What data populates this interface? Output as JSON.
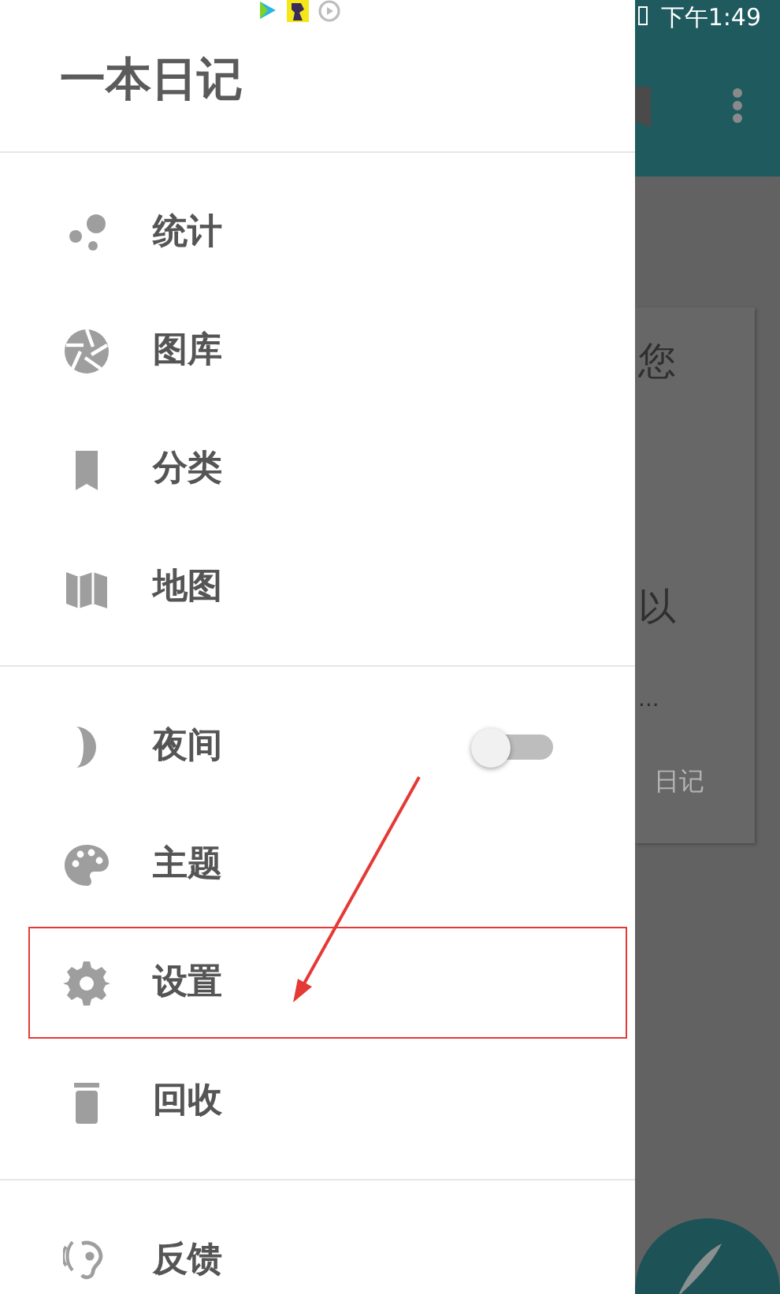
{
  "status_bar": {
    "time": "下午1:49"
  },
  "drawer": {
    "title": "一本日记",
    "groups": [
      {
        "items": [
          {
            "kind": "link",
            "label": "统计",
            "annotated": false
          },
          {
            "kind": "link",
            "label": "图库",
            "annotated": false
          },
          {
            "kind": "link",
            "label": "分类",
            "annotated": false
          },
          {
            "kind": "link",
            "label": "地图",
            "annotated": false
          }
        ]
      },
      {
        "items": [
          {
            "kind": "toggle",
            "label": "夜间",
            "on": false,
            "annotated": false
          },
          {
            "kind": "link",
            "label": "主题",
            "annotated": false
          },
          {
            "kind": "link",
            "label": "设置",
            "annotated": true
          },
          {
            "kind": "link",
            "label": "回收",
            "annotated": false
          }
        ]
      },
      {
        "items": [
          {
            "kind": "link",
            "label": "反馈",
            "annotated": false
          }
        ]
      }
    ]
  },
  "background": {
    "card_texts": [
      "您",
      "以",
      "...",
      "日记"
    ]
  }
}
